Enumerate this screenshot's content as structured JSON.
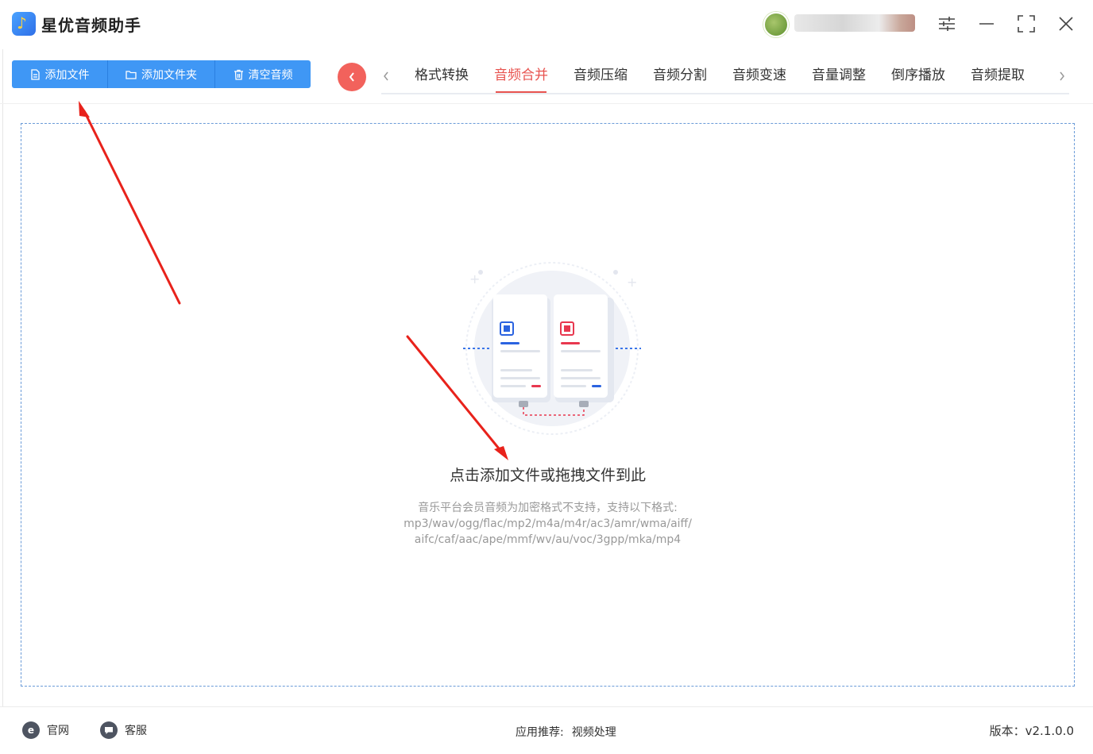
{
  "app": {
    "title": "星优音频助手"
  },
  "toolbar": {
    "add_file": "添加文件",
    "add_folder": "添加文件夹",
    "clear": "清空音频"
  },
  "tabs": [
    {
      "label": "格式转换",
      "active": false
    },
    {
      "label": "音频合并",
      "active": true
    },
    {
      "label": "音频压缩",
      "active": false
    },
    {
      "label": "音频分割",
      "active": false
    },
    {
      "label": "音频变速",
      "active": false
    },
    {
      "label": "音量调整",
      "active": false
    },
    {
      "label": "倒序播放",
      "active": false
    },
    {
      "label": "音频提取",
      "active": false
    }
  ],
  "dropzone": {
    "title": "点击添加文件或拖拽文件到此",
    "note_line1": "音乐平台会员音频为加密格式不支持，支持以下格式:",
    "note_line2": "mp3/wav/ogg/flac/mp2/m4a/m4r/ac3/amr/wma/aiff/",
    "note_line3": "aifc/caf/aac/ape/mmf/wv/au/voc/3gpp/mka/mp4"
  },
  "footer": {
    "website": "官网",
    "support": "客服",
    "recommend_label": "应用推荐:",
    "recommend_link": "视频处理",
    "version": "版本：v2.1.0.0"
  },
  "colors": {
    "accent_blue": "#3f97f5",
    "active_tab": "#e8534f",
    "back_button": "#f2625c",
    "annotation_arrow": "#e8221b"
  }
}
